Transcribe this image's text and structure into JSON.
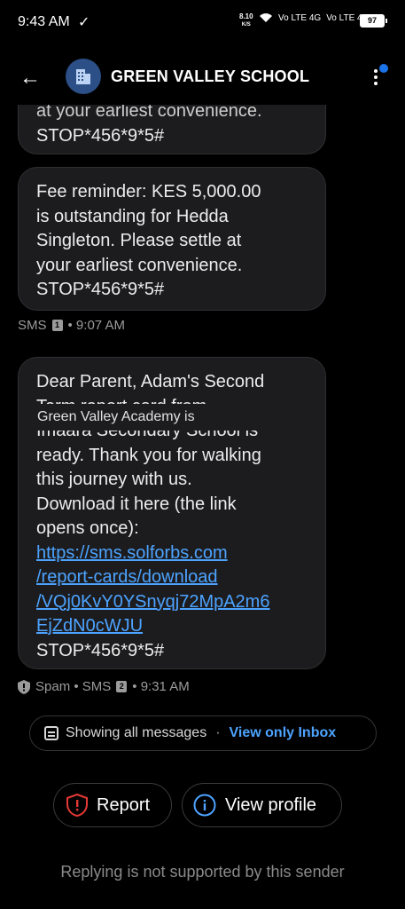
{
  "status": {
    "time": "9:43 AM",
    "speed_value": "8.10",
    "speed_unit": "K/S",
    "net1": "Vo LTE 4G",
    "net2": "Vo LTE 4G",
    "battery": "97"
  },
  "header": {
    "title": "GREEN VALLEY SCHOOL"
  },
  "messages": [
    {
      "lines": [
        "at your earliest convenience.",
        "STOP*456*9*5#"
      ]
    },
    {
      "lines": [
        "Fee reminder: KES 5,000.00",
        "is outstanding for Hedda",
        "Singleton. Please settle at",
        "your earliest convenience.",
        "STOP*456*9*5#"
      ],
      "meta": {
        "label": "SMS",
        "sim": "1",
        "time": "• 9:07 AM"
      }
    },
    {
      "lines": [
        "Dear Parent, Adam's Second",
        "Term report card from",
        "Imaara Secondary School is",
        "ready. Thank you for walking",
        "this journey with us.",
        "Download it here (the link",
        "opens once):"
      ],
      "link_lines": [
        "https://sms.solforbs.com",
        "/report-cards/download",
        "/VQj0KvY0YSnyqj72MpA2m6",
        "EjZdN0cWJU"
      ],
      "tail": "STOP*456*9*5#",
      "meta": {
        "label": "Spam • SMS",
        "sim": "2",
        "time": "• 9:31 AM"
      }
    }
  ],
  "tooltip": "Green Valley Academy is",
  "filter": {
    "showing": "Showing all messages",
    "separator": "·",
    "action": "View only Inbox"
  },
  "actions": {
    "report": "Report",
    "profile": "View profile"
  },
  "footer": "Replying is not supported by this sender",
  "colors": {
    "accent": "#4da3ff",
    "report_icon": "#e53935",
    "profile_icon": "#4da3ff",
    "avatar_bg": "#2b4f86"
  }
}
